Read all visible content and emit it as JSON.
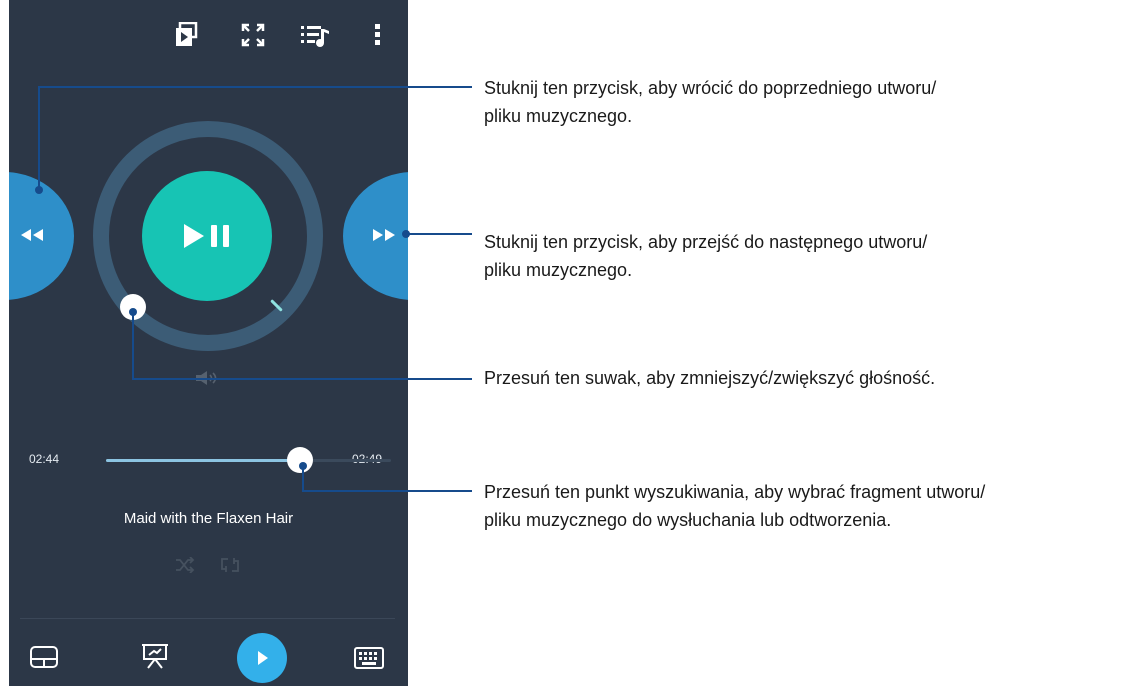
{
  "player": {
    "current_time": "02:44",
    "total_time": "02:49",
    "progress_fraction": 0.68,
    "track_title": "Maid with the Flaxen Hair"
  },
  "callouts": {
    "previous": "Stuknij ten przycisk, aby wrócić do poprzedniego utworu/\npliku muzycznego.",
    "next": "Stuknij ten przycisk, aby przejść do następnego utworu/\npliku muzycznego.",
    "volume": "Przesuń ten suwak, aby zmniejszyć/zwiększyć głośność.",
    "seek": "Przesuń ten punkt wyszukiwania, aby wybrać fragment utworu/\npliku muzycznego do wysłuchania lub odtworzenia."
  },
  "colors": {
    "panel": "#2c3747",
    "accent_blue": "#2e8fc9",
    "play_teal": "#17c4b4",
    "callout_line": "#164b8c"
  },
  "icons": [
    "cast-icon",
    "fullscreen-icon",
    "playlist-icon",
    "more-icon",
    "rewind-icon",
    "fast-forward-icon",
    "play-pause-icon",
    "volume-icon",
    "shuffle-icon",
    "repeat-icon",
    "touchpad-icon",
    "presentation-icon",
    "play-icon",
    "keyboard-icon"
  ]
}
